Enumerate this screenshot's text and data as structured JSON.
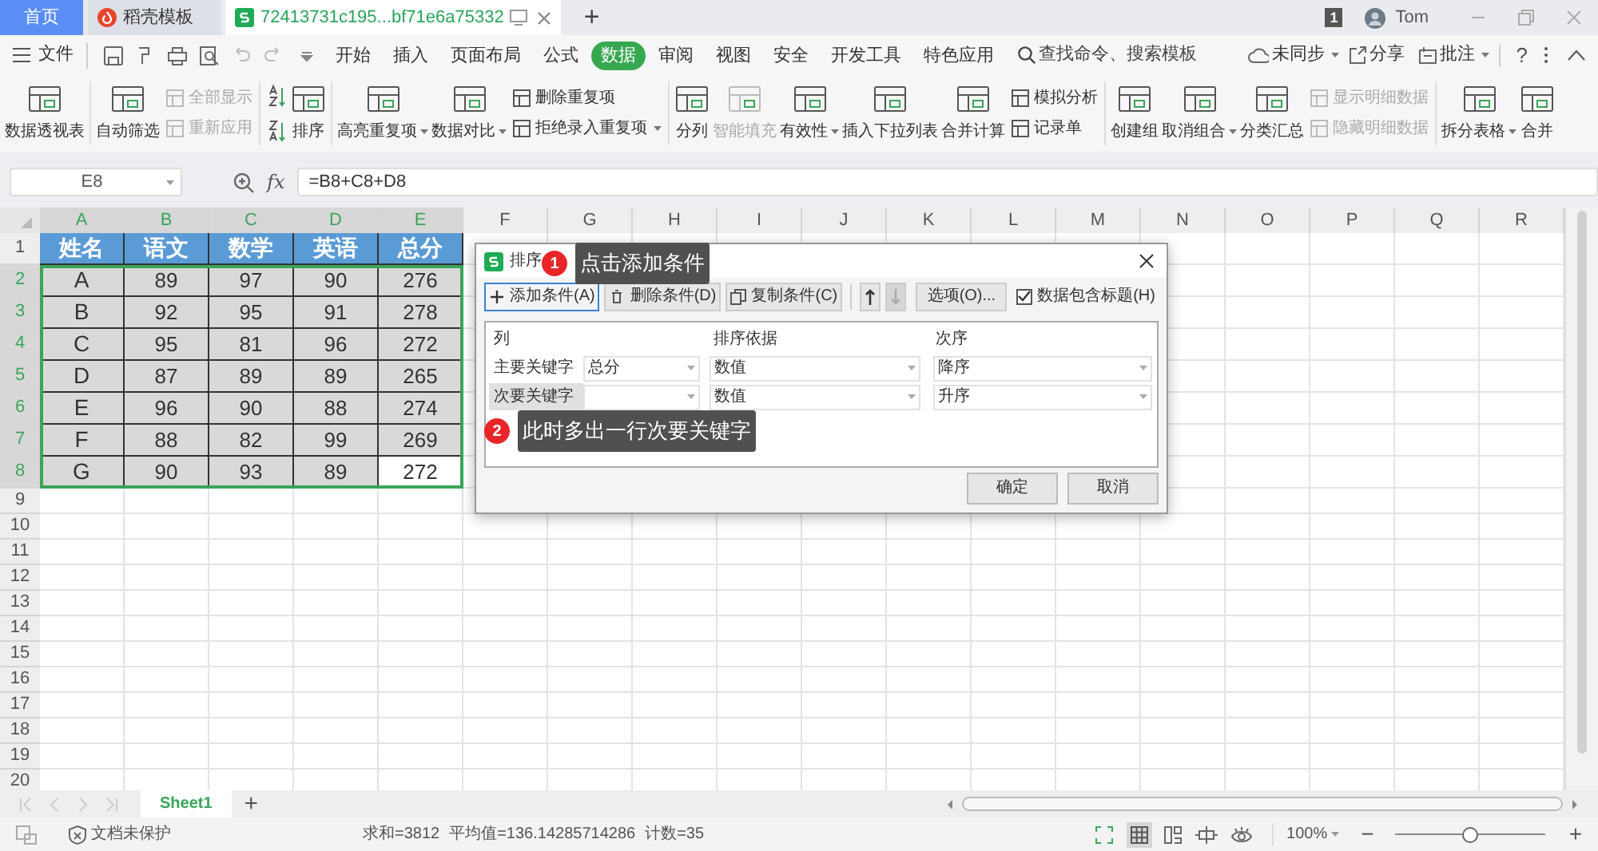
{
  "title_bar": {
    "tabs": [
      {
        "label": "首页",
        "kind": "home",
        "selected": false
      },
      {
        "label": "稻壳模板",
        "kind": "docer",
        "selected": false
      },
      {
        "label": "72413731c195...bf71e6a75332",
        "kind": "sheet",
        "selected": true
      }
    ],
    "new_tab": "+",
    "notice_count": "1",
    "user": "Tom"
  },
  "menu": {
    "file": "文件",
    "tabs": [
      {
        "label": "开始",
        "selected": false
      },
      {
        "label": "插入",
        "selected": false
      },
      {
        "label": "页面布局",
        "selected": false
      },
      {
        "label": "公式",
        "selected": false
      },
      {
        "label": "数据",
        "selected": true
      },
      {
        "label": "审阅",
        "selected": false
      },
      {
        "label": "视图",
        "selected": false
      },
      {
        "label": "安全",
        "selected": false
      },
      {
        "label": "开发工具",
        "selected": false
      },
      {
        "label": "特色应用",
        "selected": false
      }
    ],
    "search": "查找命令、搜索模板",
    "sync": "未同步",
    "share": "分享",
    "comment": "批注",
    "help": "?"
  },
  "ribbon": [
    {
      "kind": "large",
      "label": "数据透视表",
      "disabled": false,
      "dropdown": false
    },
    {
      "kind": "separator"
    },
    {
      "kind": "large",
      "label": "自动筛选",
      "disabled": false,
      "dropdown": false
    },
    {
      "kind": "stack",
      "items": [
        {
          "label": "全部显示",
          "disabled": true,
          "dropdown": false
        },
        {
          "label": "重新应用",
          "disabled": true,
          "dropdown": false
        }
      ]
    },
    {
      "kind": "separator"
    },
    {
      "kind": "sort_icons"
    },
    {
      "kind": "large",
      "label": "排序",
      "disabled": false,
      "dropdown": false
    },
    {
      "kind": "separator"
    },
    {
      "kind": "large",
      "label": "高亮重复项",
      "disabled": false,
      "dropdown": true
    },
    {
      "kind": "large",
      "label": "数据对比",
      "disabled": false,
      "dropdown": true
    },
    {
      "kind": "stack",
      "items": [
        {
          "label": "删除重复项",
          "disabled": false,
          "dropdown": false
        },
        {
          "label": "拒绝录入重复项",
          "disabled": false,
          "dropdown": true
        }
      ]
    },
    {
      "kind": "separator"
    },
    {
      "kind": "large",
      "label": "分列",
      "disabled": false,
      "dropdown": false
    },
    {
      "kind": "large",
      "label": "智能填充",
      "disabled": true,
      "dropdown": false
    },
    {
      "kind": "large",
      "label": "有效性",
      "disabled": false,
      "dropdown": true
    },
    {
      "kind": "large",
      "label": "插入下拉列表",
      "disabled": false,
      "dropdown": false
    },
    {
      "kind": "large",
      "label": "合并计算",
      "disabled": false,
      "dropdown": false
    },
    {
      "kind": "stack",
      "items": [
        {
          "label": "模拟分析",
          "disabled": false,
          "dropdown": false
        },
        {
          "label": "记录单",
          "disabled": false,
          "dropdown": false
        }
      ]
    },
    {
      "kind": "separator"
    },
    {
      "kind": "large",
      "label": "创建组",
      "disabled": false,
      "dropdown": false
    },
    {
      "kind": "large",
      "label": "取消组合",
      "disabled": false,
      "dropdown": true
    },
    {
      "kind": "large",
      "label": "分类汇总",
      "disabled": false,
      "dropdown": false
    },
    {
      "kind": "stack",
      "items": [
        {
          "label": "显示明细数据",
          "disabled": true,
          "dropdown": false
        },
        {
          "label": "隐藏明细数据",
          "disabled": true,
          "dropdown": false
        }
      ]
    },
    {
      "kind": "separator"
    },
    {
      "kind": "large",
      "label": "拆分表格",
      "disabled": false,
      "dropdown": true
    },
    {
      "kind": "large",
      "label": "合并",
      "disabled": false,
      "dropdown": false
    }
  ],
  "formula_bar": {
    "name_box": "E8",
    "fx": "fx",
    "formula": "=B8+C8+D8"
  },
  "sheet": {
    "columns": [
      {
        "label": "A",
        "highlighted": true
      },
      {
        "label": "B",
        "highlighted": true
      },
      {
        "label": "C",
        "highlighted": true
      },
      {
        "label": "D",
        "highlighted": true
      },
      {
        "label": "E",
        "highlighted": true
      },
      {
        "label": "F",
        "highlighted": false
      },
      {
        "label": "G",
        "highlighted": false
      },
      {
        "label": "H",
        "highlighted": false
      },
      {
        "label": "I",
        "highlighted": false
      },
      {
        "label": "J",
        "highlighted": false
      },
      {
        "label": "K",
        "highlighted": false
      },
      {
        "label": "L",
        "highlighted": false
      },
      {
        "label": "M",
        "highlighted": false
      },
      {
        "label": "N",
        "highlighted": false
      },
      {
        "label": "O",
        "highlighted": false
      },
      {
        "label": "P",
        "highlighted": false
      },
      {
        "label": "Q",
        "highlighted": false
      },
      {
        "label": "R",
        "highlighted": false
      }
    ],
    "rows": [
      {
        "label": "1",
        "highlighted": false
      },
      {
        "label": "2",
        "highlighted": true
      },
      {
        "label": "3",
        "highlighted": true
      },
      {
        "label": "4",
        "highlighted": true
      },
      {
        "label": "5",
        "highlighted": true
      },
      {
        "label": "6",
        "highlighted": true
      },
      {
        "label": "7",
        "highlighted": true
      },
      {
        "label": "8",
        "highlighted": true
      },
      {
        "label": "9",
        "highlighted": false
      },
      {
        "label": "10",
        "highlighted": false
      },
      {
        "label": "11",
        "highlighted": false
      },
      {
        "label": "12",
        "highlighted": false
      },
      {
        "label": "13",
        "highlighted": false
      },
      {
        "label": "14",
        "highlighted": false
      },
      {
        "label": "15",
        "highlighted": false
      },
      {
        "label": "16",
        "highlighted": false
      },
      {
        "label": "17",
        "highlighted": false
      },
      {
        "label": "18",
        "highlighted": false
      },
      {
        "label": "19",
        "highlighted": false
      },
      {
        "label": "20",
        "highlighted": false
      }
    ],
    "table": {
      "header": [
        "姓名",
        "语文",
        "数学",
        "英语",
        "总分"
      ],
      "rows": [
        [
          {
            "text": "A",
            "selected": false
          },
          {
            "text": "89",
            "selected": false
          },
          {
            "text": "97",
            "selected": false
          },
          {
            "text": "90",
            "selected": false
          },
          {
            "text": "276",
            "selected": false
          }
        ],
        [
          {
            "text": "B",
            "selected": false
          },
          {
            "text": "92",
            "selected": false
          },
          {
            "text": "95",
            "selected": false
          },
          {
            "text": "91",
            "selected": false
          },
          {
            "text": "278",
            "selected": false
          }
        ],
        [
          {
            "text": "C",
            "selected": false
          },
          {
            "text": "95",
            "selected": false
          },
          {
            "text": "81",
            "selected": false
          },
          {
            "text": "96",
            "selected": false
          },
          {
            "text": "272",
            "selected": false
          }
        ],
        [
          {
            "text": "D",
            "selected": false
          },
          {
            "text": "87",
            "selected": false
          },
          {
            "text": "89",
            "selected": false
          },
          {
            "text": "89",
            "selected": false
          },
          {
            "text": "265",
            "selected": false
          }
        ],
        [
          {
            "text": "E",
            "selected": false
          },
          {
            "text": "96",
            "selected": false
          },
          {
            "text": "90",
            "selected": false
          },
          {
            "text": "88",
            "selected": false
          },
          {
            "text": "274",
            "selected": false
          }
        ],
        [
          {
            "text": "F",
            "selected": false
          },
          {
            "text": "88",
            "selected": false
          },
          {
            "text": "82",
            "selected": false
          },
          {
            "text": "99",
            "selected": false
          },
          {
            "text": "269",
            "selected": false
          }
        ],
        [
          {
            "text": "G",
            "selected": false
          },
          {
            "text": "90",
            "selected": false
          },
          {
            "text": "93",
            "selected": false
          },
          {
            "text": "89",
            "selected": false
          },
          {
            "text": "272",
            "selected": true
          }
        ]
      ]
    }
  },
  "dialog": {
    "title": "排序",
    "toolbar": [
      {
        "label": "添加条件(A)",
        "kind": "add",
        "selected": true
      },
      {
        "label": "删除条件(D)",
        "kind": "delete",
        "selected": false
      },
      {
        "label": "复制条件(C)",
        "kind": "copy",
        "selected": false
      }
    ],
    "move_up_disabled": false,
    "move_down_disabled": true,
    "options": "选项(O)...",
    "has_header": {
      "label": "数据包含标题(H)",
      "checked": true
    },
    "columns": [
      "列",
      "排序依据",
      "次序"
    ],
    "rows": [
      {
        "label": "主要关键字",
        "column": "总分",
        "basis": "数值",
        "order": "降序",
        "selected": false
      },
      {
        "label": "次要关键字",
        "basis": "数值",
        "order": "升序",
        "selected": true
      }
    ],
    "ok": "确定",
    "cancel": "取消"
  },
  "callouts": [
    {
      "number": "1",
      "text": "点击添加条件"
    },
    {
      "number": "2",
      "text": "此时多出一行次要关键字"
    }
  ],
  "sheet_tabs": [
    {
      "label": "Sheet1",
      "selected": true
    }
  ],
  "add_sheet": "+",
  "status_bar": {
    "protection": "文档未保护",
    "sum": "求和=3812",
    "average": "平均值=136.14285714286",
    "count": "计数=35",
    "zoom": "100%",
    "zoom_out": "−",
    "zoom_in": "+",
    "zoom_slider": {
      "level": 0.5
    }
  }
}
